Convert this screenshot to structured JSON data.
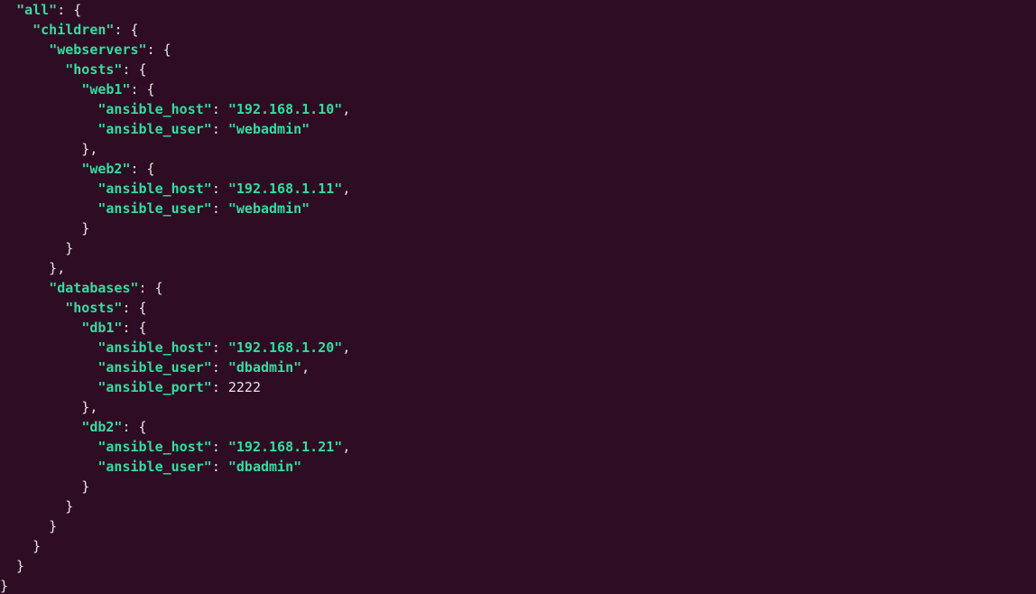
{
  "lines": [
    [
      [
        "  ",
        "p"
      ],
      [
        "\"all\"",
        "k"
      ],
      [
        ": {",
        "p"
      ]
    ],
    [
      [
        "    ",
        "p"
      ],
      [
        "\"children\"",
        "k"
      ],
      [
        ": {",
        "p"
      ]
    ],
    [
      [
        "      ",
        "p"
      ],
      [
        "\"webservers\"",
        "k"
      ],
      [
        ": {",
        "p"
      ]
    ],
    [
      [
        "        ",
        "p"
      ],
      [
        "\"hosts\"",
        "k"
      ],
      [
        ": {",
        "p"
      ]
    ],
    [
      [
        "          ",
        "p"
      ],
      [
        "\"web1\"",
        "k"
      ],
      [
        ": {",
        "p"
      ]
    ],
    [
      [
        "            ",
        "p"
      ],
      [
        "\"ansible_host\"",
        "k"
      ],
      [
        ": ",
        "p"
      ],
      [
        "\"192.168.1.10\"",
        "s"
      ],
      [
        ",",
        "p"
      ]
    ],
    [
      [
        "            ",
        "p"
      ],
      [
        "\"ansible_user\"",
        "k"
      ],
      [
        ": ",
        "p"
      ],
      [
        "\"webadmin\"",
        "s"
      ]
    ],
    [
      [
        "          },",
        "p"
      ]
    ],
    [
      [
        "          ",
        "p"
      ],
      [
        "\"web2\"",
        "k"
      ],
      [
        ": {",
        "p"
      ]
    ],
    [
      [
        "            ",
        "p"
      ],
      [
        "\"ansible_host\"",
        "k"
      ],
      [
        ": ",
        "p"
      ],
      [
        "\"192.168.1.11\"",
        "s"
      ],
      [
        ",",
        "p"
      ]
    ],
    [
      [
        "            ",
        "p"
      ],
      [
        "\"ansible_user\"",
        "k"
      ],
      [
        ": ",
        "p"
      ],
      [
        "\"webadmin\"",
        "s"
      ]
    ],
    [
      [
        "          }",
        "p"
      ]
    ],
    [
      [
        "        }",
        "p"
      ]
    ],
    [
      [
        "      },",
        "p"
      ]
    ],
    [
      [
        "      ",
        "p"
      ],
      [
        "\"databases\"",
        "k"
      ],
      [
        ": {",
        "p"
      ]
    ],
    [
      [
        "        ",
        "p"
      ],
      [
        "\"hosts\"",
        "k"
      ],
      [
        ": {",
        "p"
      ]
    ],
    [
      [
        "          ",
        "p"
      ],
      [
        "\"db1\"",
        "k"
      ],
      [
        ": {",
        "p"
      ]
    ],
    [
      [
        "            ",
        "p"
      ],
      [
        "\"ansible_host\"",
        "k"
      ],
      [
        ": ",
        "p"
      ],
      [
        "\"192.168.1.20\"",
        "s"
      ],
      [
        ",",
        "p"
      ]
    ],
    [
      [
        "            ",
        "p"
      ],
      [
        "\"ansible_user\"",
        "k"
      ],
      [
        ": ",
        "p"
      ],
      [
        "\"dbadmin\"",
        "s"
      ],
      [
        ",",
        "p"
      ]
    ],
    [
      [
        "            ",
        "p"
      ],
      [
        "\"ansible_port\"",
        "k"
      ],
      [
        ": ",
        "p"
      ],
      [
        "2222",
        "n"
      ]
    ],
    [
      [
        "          },",
        "p"
      ]
    ],
    [
      [
        "          ",
        "p"
      ],
      [
        "\"db2\"",
        "k"
      ],
      [
        ": {",
        "p"
      ]
    ],
    [
      [
        "            ",
        "p"
      ],
      [
        "\"ansible_host\"",
        "k"
      ],
      [
        ": ",
        "p"
      ],
      [
        "\"192.168.1.21\"",
        "s"
      ],
      [
        ",",
        "p"
      ]
    ],
    [
      [
        "            ",
        "p"
      ],
      [
        "\"ansible_user\"",
        "k"
      ],
      [
        ": ",
        "p"
      ],
      [
        "\"dbadmin\"",
        "s"
      ]
    ],
    [
      [
        "          }",
        "p"
      ]
    ],
    [
      [
        "        }",
        "p"
      ]
    ],
    [
      [
        "      }",
        "p"
      ]
    ],
    [
      [
        "    }",
        "p"
      ]
    ],
    [
      [
        "  }",
        "p"
      ]
    ],
    [
      [
        "}",
        "p"
      ]
    ]
  ],
  "inventory": {
    "all": {
      "children": {
        "webservers": {
          "hosts": {
            "web1": {
              "ansible_host": "192.168.1.10",
              "ansible_user": "webadmin"
            },
            "web2": {
              "ansible_host": "192.168.1.11",
              "ansible_user": "webadmin"
            }
          }
        },
        "databases": {
          "hosts": {
            "db1": {
              "ansible_host": "192.168.1.20",
              "ansible_user": "dbadmin",
              "ansible_port": 2222
            },
            "db2": {
              "ansible_host": "192.168.1.21",
              "ansible_user": "dbadmin"
            }
          }
        }
      }
    }
  }
}
